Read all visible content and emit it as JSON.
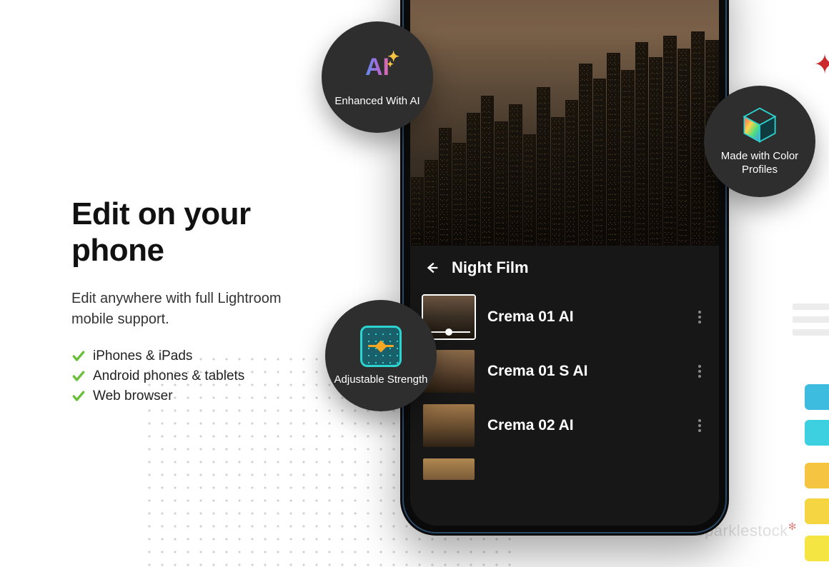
{
  "left": {
    "heading": "Edit on your phone",
    "subheading": "Edit anywhere with full Lightroom mobile support.",
    "features": [
      "iPhones & iPads",
      "Android phones & tablets",
      "Web browser"
    ]
  },
  "phone": {
    "panel_title": "Night Film",
    "presets": [
      {
        "name": "Crema 01 AI",
        "selected": true
      },
      {
        "name": "Crema 01 S AI",
        "selected": false
      },
      {
        "name": "Crema 02 AI",
        "selected": false
      }
    ]
  },
  "badges": {
    "ai": {
      "icon_text": "AI",
      "label": "Enhanced With AI"
    },
    "profiles": {
      "label": "Made with Color Profiles"
    },
    "strength": {
      "label": "Adjustable Strength"
    }
  },
  "watermark": "sparklestock",
  "colors": {
    "check": "#6bbf3a",
    "badge_bg": "#2e2e2e",
    "accent_teal": "#2dd4cf"
  }
}
